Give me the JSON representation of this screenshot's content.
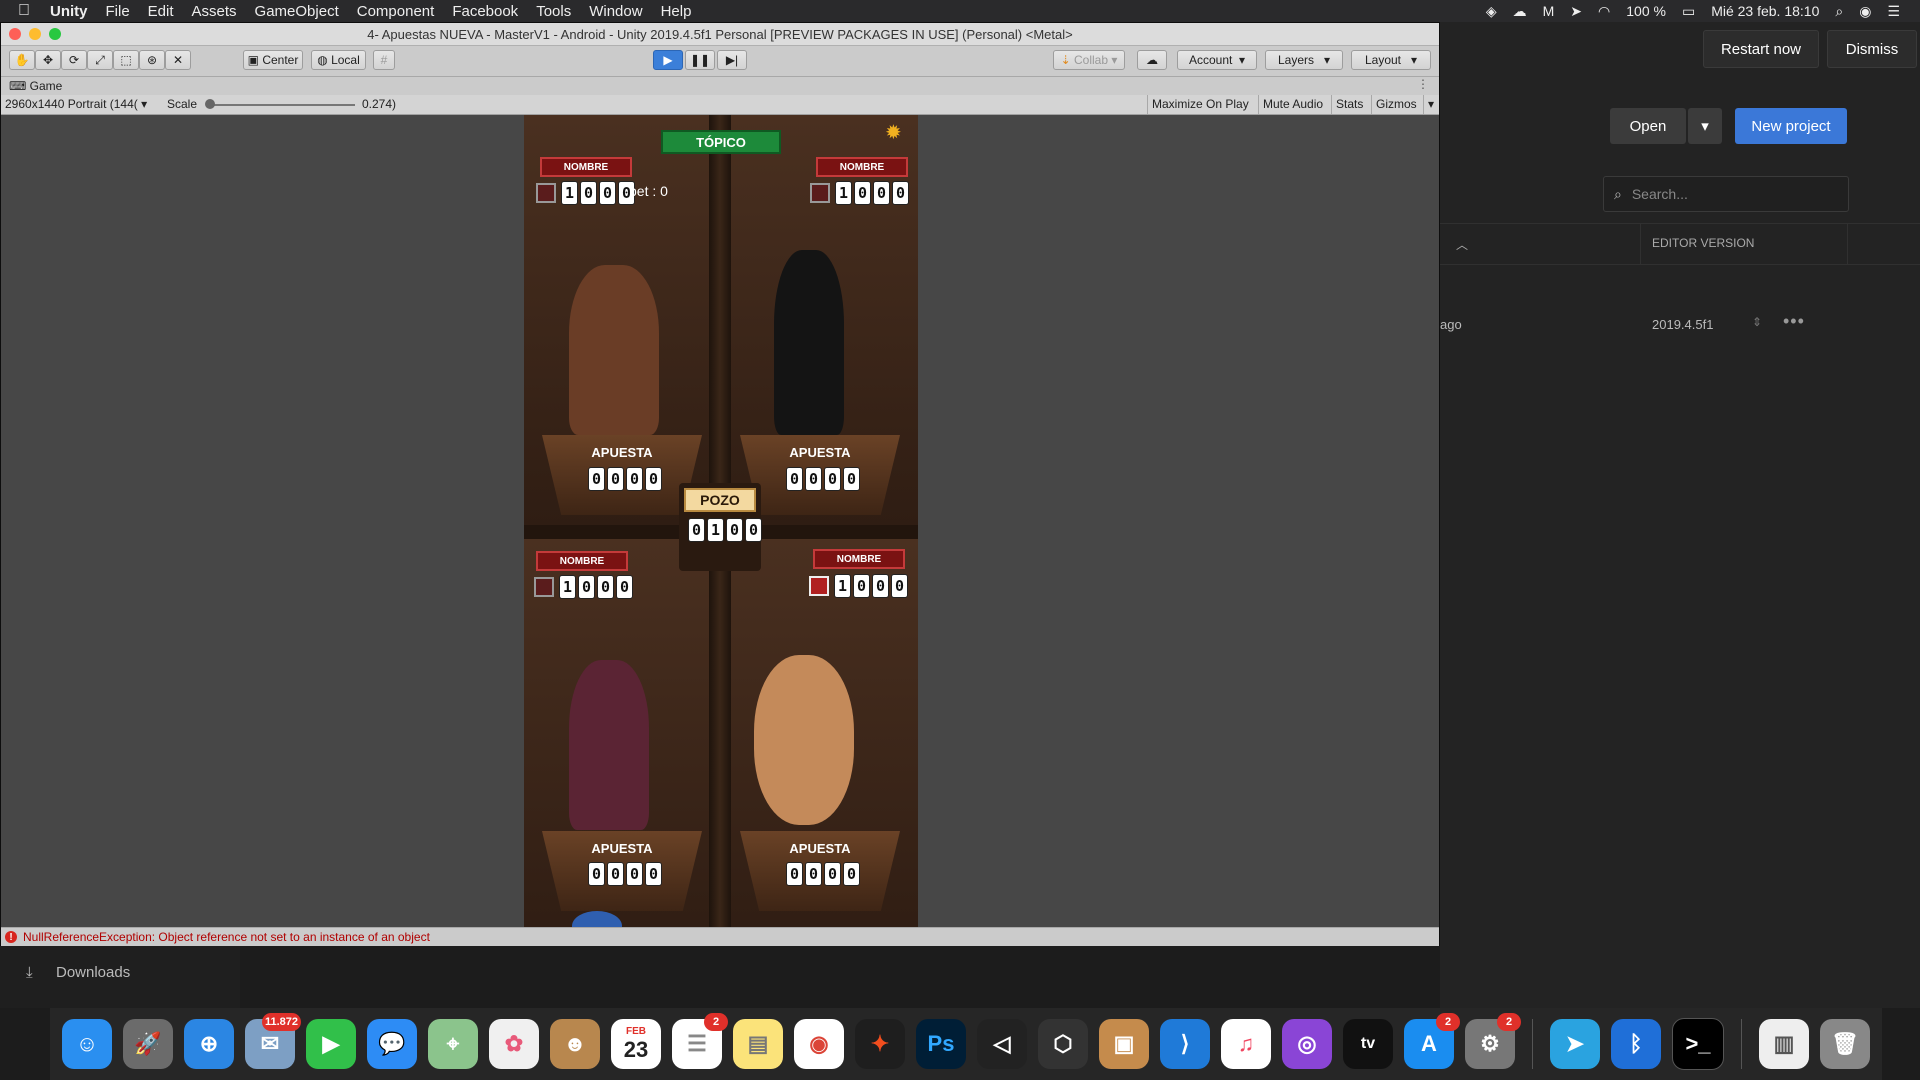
{
  "menubar": {
    "app": "Unity",
    "items": [
      "File",
      "Edit",
      "Assets",
      "GameObject",
      "Component",
      "Facebook",
      "Tools",
      "Window",
      "Help"
    ],
    "battery": "100 %",
    "datetime": "Mié 23 feb.  18:10"
  },
  "hub": {
    "restart": "Restart now",
    "dismiss": "Dismiss",
    "open": "Open",
    "new_project": "New project",
    "search_placeholder": "Search...",
    "col_editor_version": "EDITOR VERSION",
    "row_modified": "ago",
    "row_version": "2019.4.5f1"
  },
  "unity": {
    "title": "4- Apuestas NUEVA - MasterV1 - Android - Unity 2019.4.5f1 Personal [PREVIEW PACKAGES IN USE] (Personal) <Metal>",
    "toolbar": {
      "center": "Center",
      "local": "Local",
      "collab": "Collab",
      "account": "Account",
      "layers": "Layers",
      "layout": "Layout"
    },
    "tab": "Game",
    "gamebar": {
      "resolution": "2960x1440 Portrait (144(",
      "scale_label": "Scale",
      "scale_value": "0.274)",
      "options": [
        "Maximize On Play",
        "Mute Audio",
        "Stats",
        "Gizmos"
      ]
    },
    "status_error": "NullReferenceException: Object reference not set to an instance of an object"
  },
  "game": {
    "topico": "TÓPICO",
    "bet_text": "bet : 0",
    "nombre": "NOMBRE",
    "apuesta": "APUESTA",
    "pozo": "POZO",
    "players": [
      {
        "coins": [
          "1",
          "0",
          "0",
          "0"
        ],
        "bet": [
          "0",
          "0",
          "0",
          "0"
        ]
      },
      {
        "coins": [
          "1",
          "0",
          "0",
          "0"
        ],
        "bet": [
          "0",
          "0",
          "0",
          "0"
        ]
      },
      {
        "coins": [
          "1",
          "0",
          "0",
          "0"
        ],
        "bet": [
          "0",
          "0",
          "0",
          "0"
        ]
      },
      {
        "coins": [
          "1",
          "0",
          "0",
          "0"
        ],
        "bet": [
          "0",
          "0",
          "0",
          "0"
        ]
      }
    ],
    "pot": [
      "0",
      "1",
      "0",
      "0"
    ]
  },
  "downloads": "Downloads",
  "dock": {
    "badges": {
      "mail": "11.872",
      "reminders": "2",
      "appstore": "2",
      "prefs": "2"
    },
    "calendar_month": "FEB",
    "calendar_day": "23",
    "ps": "Ps",
    "tv": "tv"
  }
}
